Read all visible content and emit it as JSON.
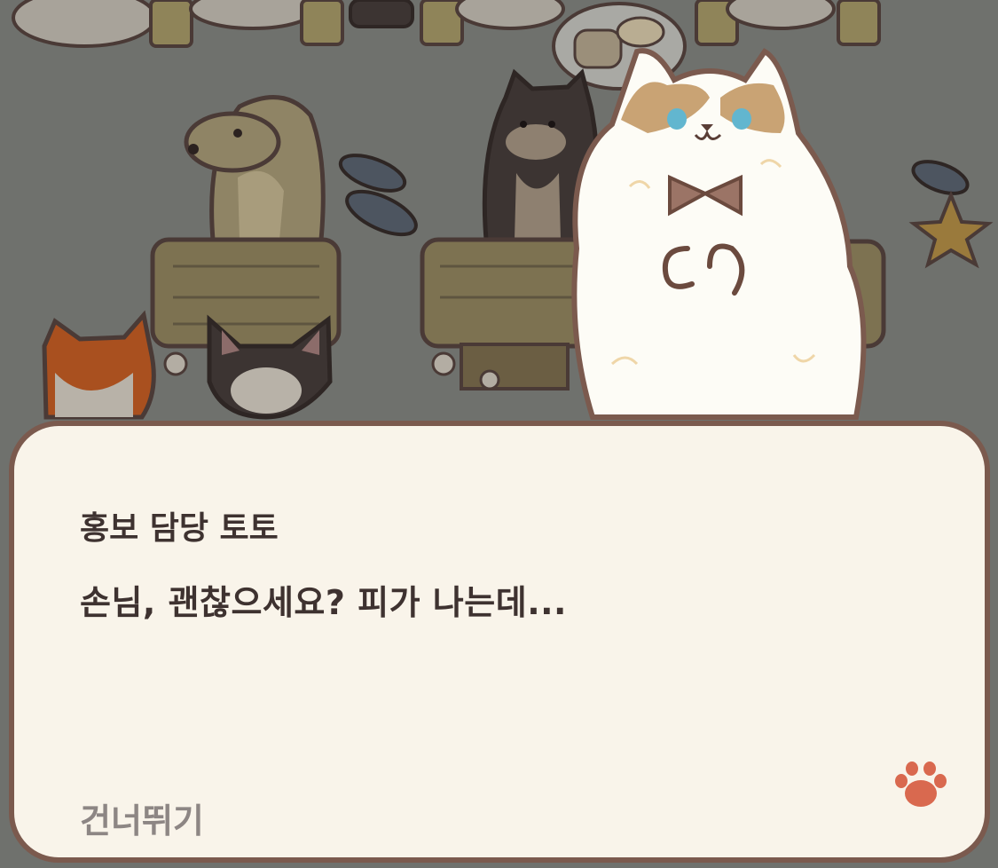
{
  "dialog": {
    "speaker": "홍보 담당 토토",
    "message": "손님, 괜찮으세요? 피가 나는데...",
    "skip_label": "건너뛰기"
  },
  "icons": {
    "next": "paw-icon"
  },
  "colors": {
    "background_dim": "#6f716d",
    "dialog_bg": "#f9f4ea",
    "dialog_border": "#7b5a4e",
    "text": "#3e3230",
    "skip_text": "#8d8684",
    "paw": "#d9694f"
  }
}
